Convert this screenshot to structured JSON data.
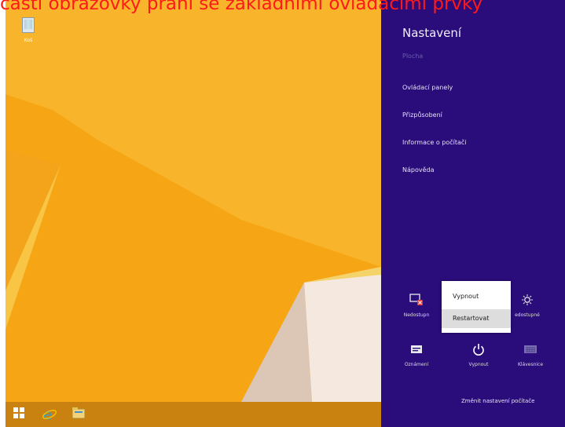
{
  "caption": "části obrazovky prání se základními ovládacími prvky",
  "desktop": {
    "recycle_bin_label": "Koš"
  },
  "charms": {
    "title": "Nastavení",
    "subtitle": "Plocha",
    "links": [
      "Ovládací panely",
      "Přizpůsobení",
      "Informace o počítači",
      "Nápověda"
    ],
    "quick_settings": [
      {
        "label": "Nedostupn",
        "icon": "network-unavailable-icon"
      },
      {
        "label": "edostupné",
        "icon": "brightness-icon"
      },
      {
        "label": "Oznámení",
        "icon": "notifications-icon"
      },
      {
        "label": "Vypnout",
        "icon": "power-icon"
      },
      {
        "label": "Klávesnice",
        "icon": "keyboard-icon"
      }
    ],
    "change_settings": "Změnit nastavení počítače"
  },
  "power_menu": {
    "items": [
      "Vypnout",
      "Restartovat"
    ],
    "selected": "Restartovat"
  },
  "taskbar": {
    "items": [
      "start-icon",
      "internet-explorer-icon",
      "file-explorer-icon"
    ]
  },
  "colors": {
    "desktop_orange": "#f6a614",
    "charms_purple": "#2a0c7a",
    "caption_red": "#ff1a1a"
  }
}
